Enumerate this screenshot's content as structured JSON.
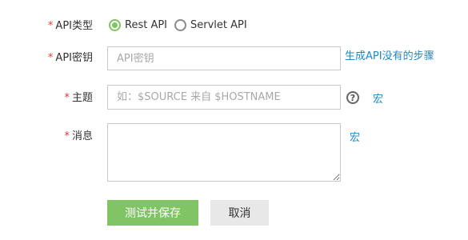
{
  "form": {
    "api_type": {
      "label": "API类型",
      "options": [
        {
          "label": "Rest API",
          "selected": true
        },
        {
          "label": "Servlet API",
          "selected": false
        }
      ]
    },
    "api_key": {
      "label": "API密钥",
      "value": "",
      "placeholder": "API密钥",
      "help_link": "生成API没有的步骤"
    },
    "subject": {
      "label": "主题",
      "value": "",
      "placeholder": "如：$SOURCE 来自 $HOSTNAME",
      "help_icon": "question-circle-icon",
      "macro_link": "宏"
    },
    "message": {
      "label": "消息",
      "value": "",
      "macro_link": "宏"
    },
    "required_marker": "*"
  },
  "actions": {
    "save_label": "测试并保存",
    "cancel_label": "取消"
  },
  "colors": {
    "accent": "#80c466",
    "required": "#e4393c",
    "link": "#1a8cc4"
  }
}
